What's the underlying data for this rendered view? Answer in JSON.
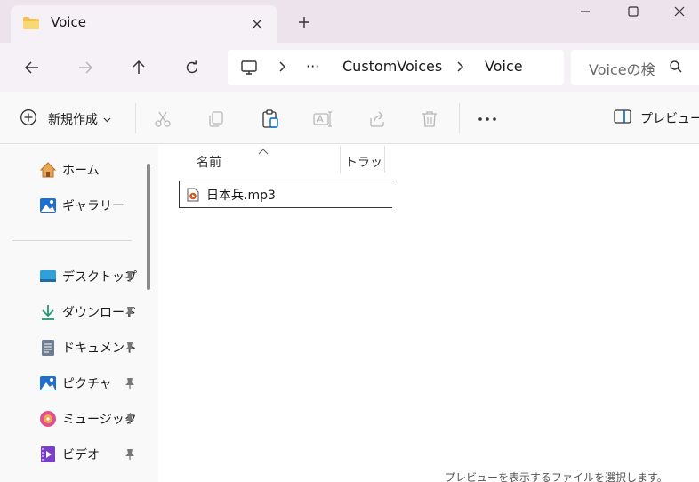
{
  "tab": {
    "title": "Voice"
  },
  "address": {
    "ellipsis": "···",
    "crumbs": [
      "CustomVoices",
      "Voice"
    ]
  },
  "search": {
    "placeholder": "Voiceの検"
  },
  "toolbar": {
    "new_label": "新規作成",
    "preview_label": "プレビュー"
  },
  "sidebar": {
    "top_items": [
      {
        "label": "ホーム",
        "icon": "home-icon"
      },
      {
        "label": "ギャラリー",
        "icon": "gallery-icon"
      }
    ],
    "pinned_items": [
      {
        "label": "デスクトップ",
        "icon": "desktop-icon"
      },
      {
        "label": "ダウンロード",
        "icon": "download-icon"
      },
      {
        "label": "ドキュメント",
        "icon": "documents-icon"
      },
      {
        "label": "ピクチャ",
        "icon": "pictures-icon"
      },
      {
        "label": "ミュージック",
        "icon": "music-icon"
      },
      {
        "label": "ビデオ",
        "icon": "videos-icon"
      }
    ]
  },
  "columns": {
    "name": "名前",
    "type": "トラック"
  },
  "files": [
    {
      "name": "日本兵.mp3",
      "icon": "audio-file-icon"
    }
  ],
  "preview_pane": {
    "message": "プレビューを表示するファイルを選択します。"
  },
  "colors": {
    "folder": "#f2c14e",
    "accent": "#0067c0",
    "titlebar": "#ece3ec",
    "navbar": "#f6f1f6"
  }
}
